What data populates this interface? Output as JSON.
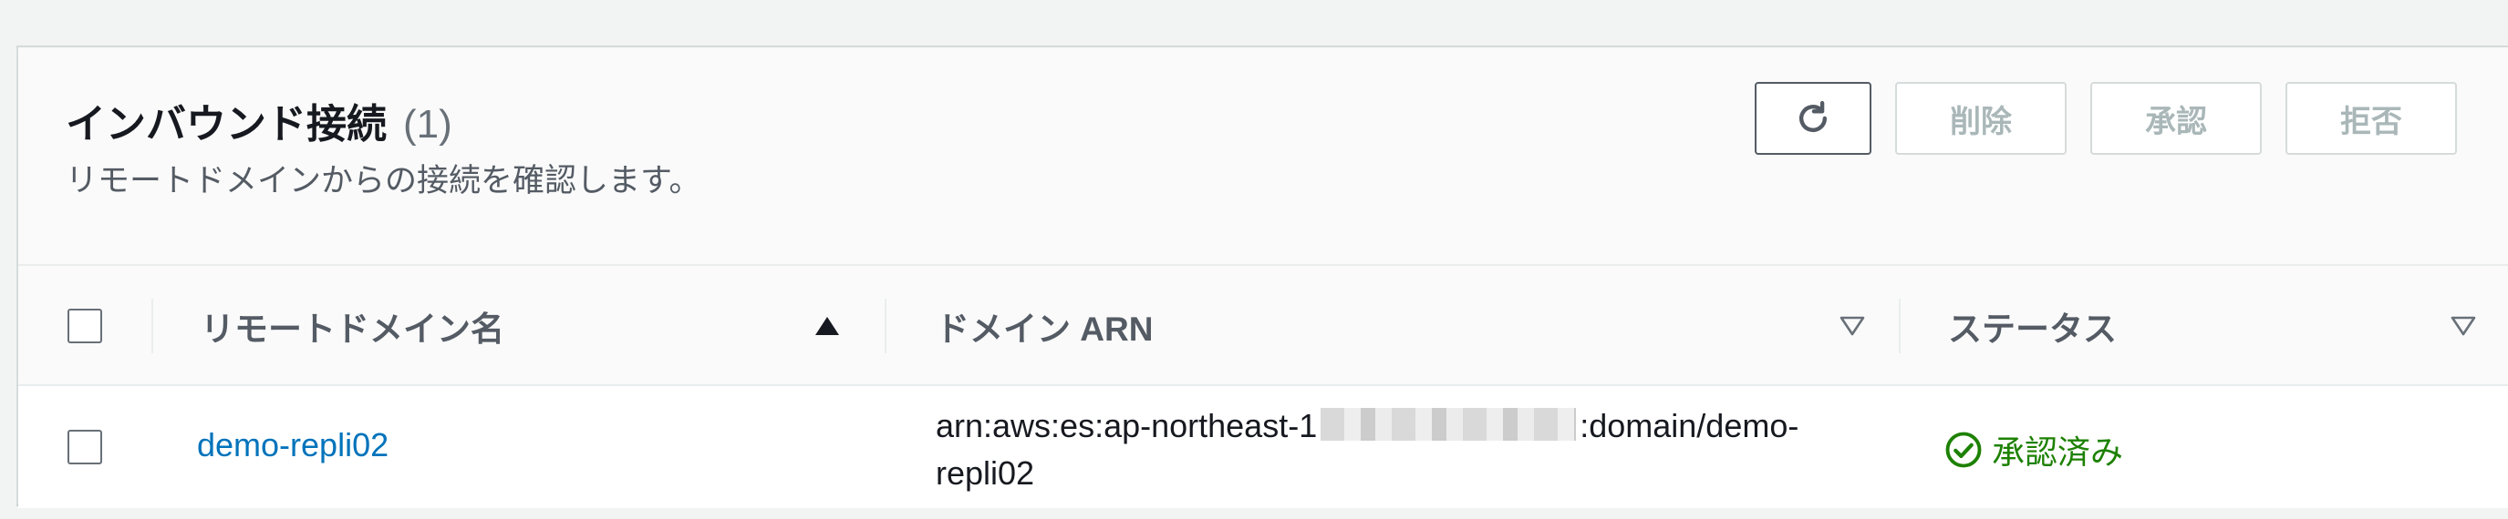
{
  "panel": {
    "title": "インバウンド接続",
    "count": "(1)",
    "description": "リモートドメインからの接続を確認します。"
  },
  "actions": {
    "refresh_icon": "refresh-icon",
    "delete_label": "削除",
    "approve_label": "承認",
    "reject_label": "拒否"
  },
  "table": {
    "columns": [
      {
        "label": "リモートドメイン名",
        "sort": "ascending"
      },
      {
        "label": "ドメイン ARN",
        "sort": "none"
      },
      {
        "label": "ステータス",
        "sort": "none"
      }
    ],
    "rows": [
      {
        "remote_domain": "demo-repli02",
        "arn_prefix": "arn:aws:es:ap-northeast-1",
        "arn_suffix": ":domain/demo-",
        "arn_line2": "repli02",
        "status": "承認済み",
        "status_icon": "check-circle-icon"
      }
    ]
  },
  "colors": {
    "link": "#0073bb",
    "success": "#1d8102",
    "disabled_text": "#aab7b8"
  }
}
